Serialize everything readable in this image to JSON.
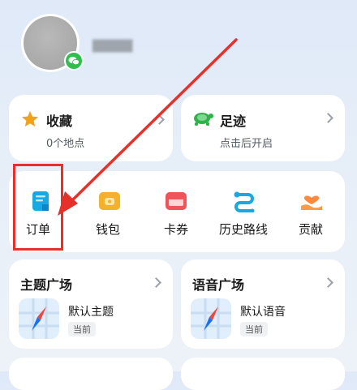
{
  "profile": {
    "username_blurred": "▆▆▆▆",
    "wechat_badge_icon": "wechat-icon"
  },
  "favorites": {
    "title": "收藏",
    "subtitle": "0个地点",
    "icon": "star-icon"
  },
  "footprint": {
    "title": "足迹",
    "subtitle": "点击后开启",
    "icon": "turtle-icon"
  },
  "services": [
    {
      "label": "订单",
      "icon": "order-icon"
    },
    {
      "label": "钱包",
      "icon": "wallet-icon"
    },
    {
      "label": "卡券",
      "icon": "coupon-icon"
    },
    {
      "label": "历史路线",
      "icon": "route-icon"
    },
    {
      "label": "贡献",
      "icon": "contribute-icon"
    }
  ],
  "theme_square": {
    "title": "主题广场",
    "item_label": "默认主题",
    "badge": "当前"
  },
  "voice_square": {
    "title": "语音广场",
    "item_label": "默认语音",
    "badge": "当前"
  },
  "colors": {
    "annotation_red": "#e8302a",
    "accent_blue": "#1a9ee8"
  }
}
